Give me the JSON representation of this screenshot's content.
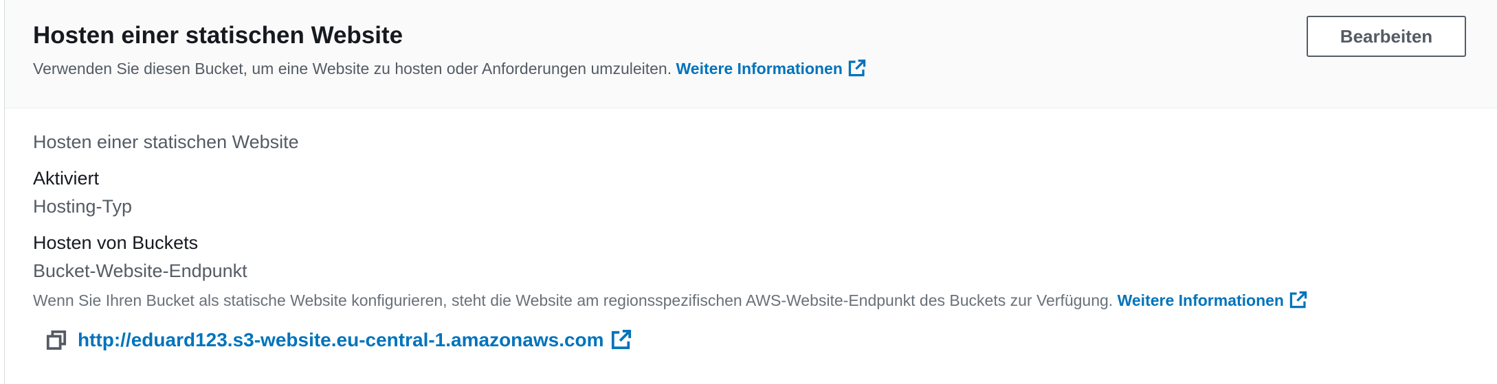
{
  "header": {
    "title": "Hosten einer statischen Website",
    "description": "Verwenden Sie diesen Bucket, um eine Website zu hosten oder Anforderungen umzuleiten.",
    "more_info_label": "Weitere Informationen",
    "edit_label": "Bearbeiten"
  },
  "properties": {
    "hosting_label": "Hosten einer statischen Website",
    "hosting_value": "Aktiviert",
    "hosting_type_label": "Hosting-Typ",
    "hosting_type_value": "Hosten von Buckets",
    "endpoint_label": "Bucket-Website-Endpunkt",
    "endpoint_hint": "Wenn Sie Ihren Bucket als statische Website konfigurieren, steht die Website am regionsspezifischen AWS-Website-Endpunkt des Buckets zur Verfügung.",
    "endpoint_more_info_label": "Weitere Informationen",
    "endpoint_url": "http://eduard123.s3-website.eu-central-1.amazonaws.com"
  },
  "icons": {
    "external_link": "external-link-icon",
    "copy": "copy-icon"
  },
  "colors": {
    "link": "#0073bb",
    "header_bg": "#fafafa",
    "text_primary": "#16191f",
    "text_secondary": "#545b64"
  }
}
